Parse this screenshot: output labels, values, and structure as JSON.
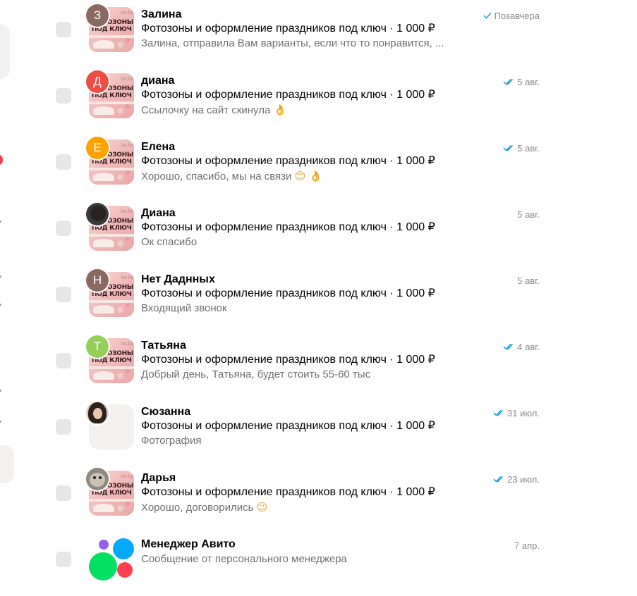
{
  "ad": {
    "title": "Фотозоны и оформление праздников под ключ · 1 000 ₽",
    "thumb_title": "ФОТОЗОНЫ ПОД КЛЮЧ",
    "thumb_brand": "bo.ba"
  },
  "chats": [
    {
      "name": "Залина",
      "avatar_letter": "З",
      "avatar_color": "#8a6a60",
      "message": "Залина, отправила Вам варианты, если что то понравится, ...",
      "date": "Позавчера",
      "status": "read-single",
      "emoji": ""
    },
    {
      "name": "диана",
      "avatar_letter": "Д",
      "avatar_color": "#ef4d43",
      "message": "Ссылочку на сайт скинула",
      "date": "5 авг.",
      "status": "read-double",
      "emoji": "👌"
    },
    {
      "name": "Елена",
      "avatar_letter": "Е",
      "avatar_color": "#ffa200",
      "message": "Хорошо, спасибо, мы на связи",
      "date": "5 авг.",
      "status": "read-double",
      "emoji": "😊 👌"
    },
    {
      "name": "Диана",
      "avatar_letter": "",
      "avatar_color": "#3a3a3a",
      "message": "Ок спасибо",
      "date": "5 авг.",
      "status": "none",
      "emoji": ""
    },
    {
      "name": "Нет Даднных",
      "avatar_letter": "Н",
      "avatar_color": "#8a6a60",
      "message": "Входящий звонок",
      "date": "5 авг.",
      "status": "none",
      "emoji": ""
    },
    {
      "name": "Татьяна",
      "avatar_letter": "Т",
      "avatar_color": "#95cf5a",
      "message": "Добрый день, Татьяна, будет стоить 55-60 тыс",
      "date": "4 авг.",
      "status": "read-double",
      "emoji": ""
    },
    {
      "name": "Сюзанна",
      "avatar_letter": "",
      "avatar_color": "#d7cfc7",
      "message": "Фотография",
      "date": "31 июл.",
      "status": "read-double",
      "emoji": ""
    },
    {
      "name": "Дарья",
      "avatar_letter": "",
      "avatar_color": "#8d8a80",
      "message": "Хорошо, договорились",
      "date": "23 июл.",
      "status": "read-double",
      "emoji": "😉"
    },
    {
      "name": "Менеджер Авито",
      "avatar_letter": "",
      "avatar_color": "",
      "message": "Сообщение от персонального менеджера",
      "date": "7 апр.",
      "status": "none",
      "emoji": ""
    }
  ],
  "colors": {
    "check_blue": "#1c9ad6",
    "avito_blue": "#00aaff",
    "avito_green": "#04e061",
    "avito_red": "#ff4053",
    "avito_purple": "#965eeb"
  }
}
